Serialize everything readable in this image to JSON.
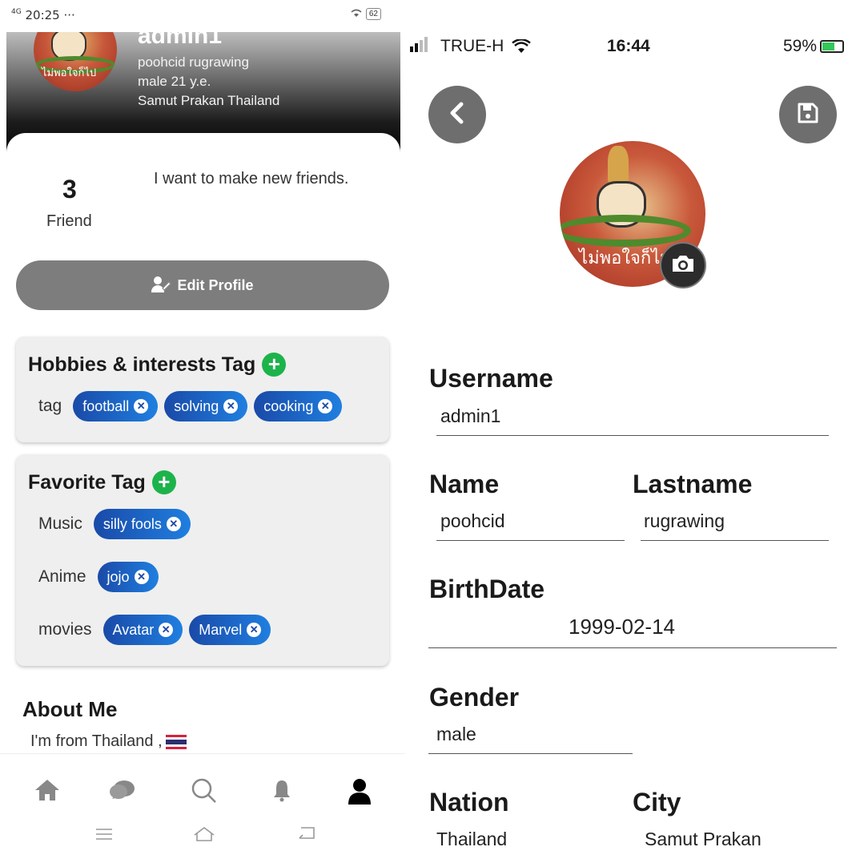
{
  "left_phone": {
    "status_bar": {
      "time": "20:25",
      "dots": "···",
      "network": "4G",
      "battery": "62"
    },
    "profile": {
      "username": "admin1",
      "full_name": "poohcid rugrawing",
      "gender_age": "male 21 y.e.",
      "location": "Samut Prakan Thailand",
      "avatar_text": "ไม่พอใจก็ไป"
    },
    "friends": {
      "count": "3",
      "label": "Friend"
    },
    "bio": "I want to make new friends.",
    "edit_button": "Edit Profile",
    "hobbies": {
      "title": "Hobbies & interests Tag",
      "row_label": "tag",
      "chips": [
        "football",
        "solving",
        "cooking"
      ]
    },
    "favorite": {
      "title": "Favorite Tag",
      "rows": [
        {
          "label": "Music",
          "chips": [
            "silly fools"
          ]
        },
        {
          "label": "Anime",
          "chips": [
            "jojo"
          ]
        },
        {
          "label": "movies",
          "chips": [
            "Avatar",
            "Marvel"
          ]
        }
      ]
    },
    "about": {
      "title": "About Me",
      "text": "I'm from Thailand ,"
    },
    "bottom_nav": [
      "home-icon",
      "chat-icon",
      "search-icon",
      "bell-icon",
      "profile-icon"
    ],
    "active_nav": "profile-icon",
    "system_nav": [
      "menu-icon",
      "home-outline-icon",
      "back-icon"
    ],
    "chip_colors": [
      "#1a4aa8",
      "#1f7fe0"
    ],
    "plus_color": "#1db34b"
  },
  "right_phone": {
    "status_bar": {
      "carrier": "TRUE-H",
      "time": "16:44",
      "battery": "59%",
      "battery_level": 0.59
    },
    "avatar_text": "ไม่พอใจก็ไป สการัดล",
    "fields": {
      "username": {
        "label": "Username",
        "value": "admin1"
      },
      "name": {
        "label": "Name",
        "value": "poohcid"
      },
      "lastname": {
        "label": "Lastname",
        "value": "rugrawing"
      },
      "birthdate": {
        "label": "BirthDate",
        "value": "1999-02-14"
      },
      "gender": {
        "label": "Gender",
        "value": "male"
      },
      "nation": {
        "label": "Nation",
        "value": "Thailand"
      },
      "city": {
        "label": "City",
        "value": "Samut Prakan"
      }
    },
    "icons": [
      "back-icon",
      "save-icon",
      "camera-icon"
    ],
    "button_color": "#6e6e6e"
  }
}
